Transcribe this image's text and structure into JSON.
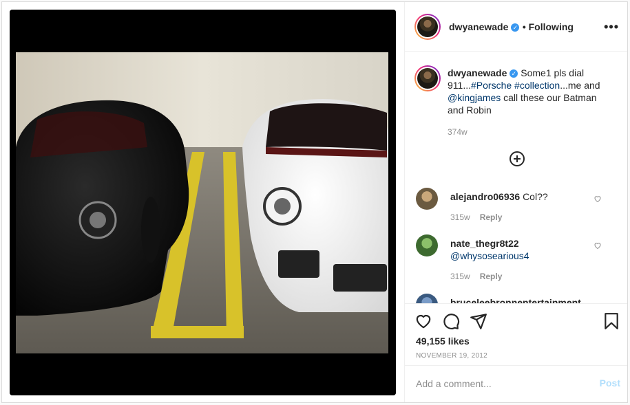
{
  "post": {
    "author": "dwyanewade",
    "follow_status": "• Following",
    "more_icon": "more-horizontal-icon",
    "photo_alt": "Black and white Porsche cars parked side by side in a garage"
  },
  "caption": {
    "username": "dwyanewade",
    "text_1": "Some1 pls dial 911...",
    "hashtag_porsche": "#Porsche",
    "space": " ",
    "hashtag_collection": "#collection",
    "text_2": "...me and ",
    "mention_kingjames": "@kingjames",
    "text_3": " call these our Batman and Robin",
    "timestamp": "374w"
  },
  "comments": [
    {
      "username": "alejandro06936",
      "text": "Col??",
      "age": "315w",
      "reply_label": "Reply"
    },
    {
      "username": "nate_thegr8t22",
      "mention": "@whysosearious4",
      "age": "315w",
      "reply_label": "Reply"
    },
    {
      "username": "bruceleebronnentertainment"
    }
  ],
  "actions": {
    "likes": "49,155 likes",
    "date": "NOVEMBER 19, 2012"
  },
  "add_comment": {
    "placeholder": "Add a comment...",
    "post_label": "Post"
  },
  "colors": {
    "link": "#00376b",
    "verified": "#3897f0",
    "post_disabled": "#b2dffc",
    "muted": "#8e8e8e"
  }
}
